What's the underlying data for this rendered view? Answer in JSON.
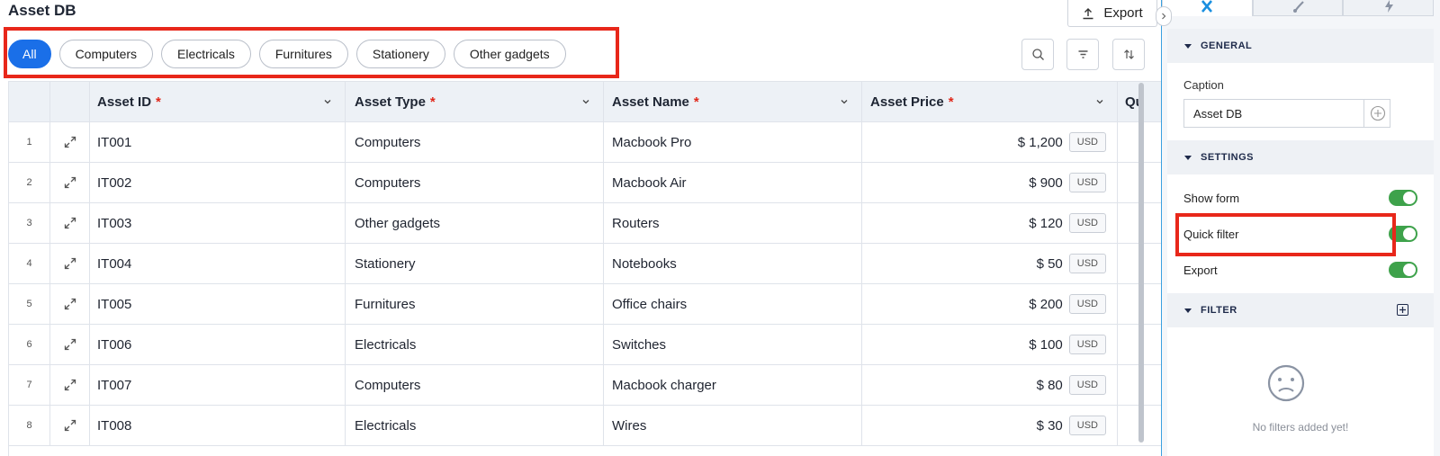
{
  "page": {
    "title": "Asset DB",
    "export_label": "Export"
  },
  "quick_filter": {
    "chips": [
      {
        "label": "All",
        "active": true
      },
      {
        "label": "Computers",
        "active": false
      },
      {
        "label": "Electricals",
        "active": false
      },
      {
        "label": "Furnitures",
        "active": false
      },
      {
        "label": "Stationery",
        "active": false
      },
      {
        "label": "Other gadgets",
        "active": false
      }
    ]
  },
  "toolbar": {
    "icons": [
      "search-icon",
      "filter-icon",
      "sort-icon"
    ]
  },
  "grid": {
    "columns": [
      {
        "label": "Asset ID",
        "required": "*"
      },
      {
        "label": "Asset Type",
        "required": "*"
      },
      {
        "label": "Asset Name",
        "required": "*"
      },
      {
        "label": "Asset Price",
        "required": "*"
      },
      {
        "label": "Qu",
        "required": ""
      }
    ],
    "rows": [
      {
        "num": "1",
        "id": "IT001",
        "type": "Computers",
        "name": "Macbook Pro",
        "price": "$ 1,200",
        "currency": "USD"
      },
      {
        "num": "2",
        "id": "IT002",
        "type": "Computers",
        "name": "Macbook Air",
        "price": "$ 900",
        "currency": "USD"
      },
      {
        "num": "3",
        "id": "IT003",
        "type": "Other gadgets",
        "name": "Routers",
        "price": "$ 120",
        "currency": "USD"
      },
      {
        "num": "4",
        "id": "IT004",
        "type": "Stationery",
        "name": "Notebooks",
        "price": "$ 50",
        "currency": "USD"
      },
      {
        "num": "5",
        "id": "IT005",
        "type": "Furnitures",
        "name": "Office chairs",
        "price": "$ 200",
        "currency": "USD"
      },
      {
        "num": "6",
        "id": "IT006",
        "type": "Electricals",
        "name": "Switches",
        "price": "$ 100",
        "currency": "USD"
      },
      {
        "num": "7",
        "id": "IT007",
        "type": "Computers",
        "name": "Macbook charger",
        "price": "$ 80",
        "currency": "USD"
      },
      {
        "num": "8",
        "id": "IT008",
        "type": "Electricals",
        "name": "Wires",
        "price": "$ 30",
        "currency": "USD"
      }
    ]
  },
  "panel": {
    "general": {
      "title": "GENERAL",
      "caption_label": "Caption",
      "caption_value": "Asset DB"
    },
    "settings": {
      "title": "SETTINGS",
      "toggles": [
        {
          "label": "Show form",
          "on": true
        },
        {
          "label": "Quick filter",
          "on": true
        },
        {
          "label": "Export",
          "on": true
        }
      ]
    },
    "filter": {
      "title": "FILTER",
      "empty_message": "No filters added yet!"
    }
  },
  "colors": {
    "accent": "#1a6fe8",
    "highlight": "#e8271a",
    "toggle_on": "#3ea24b",
    "panel_border": "#3aa0e0"
  }
}
